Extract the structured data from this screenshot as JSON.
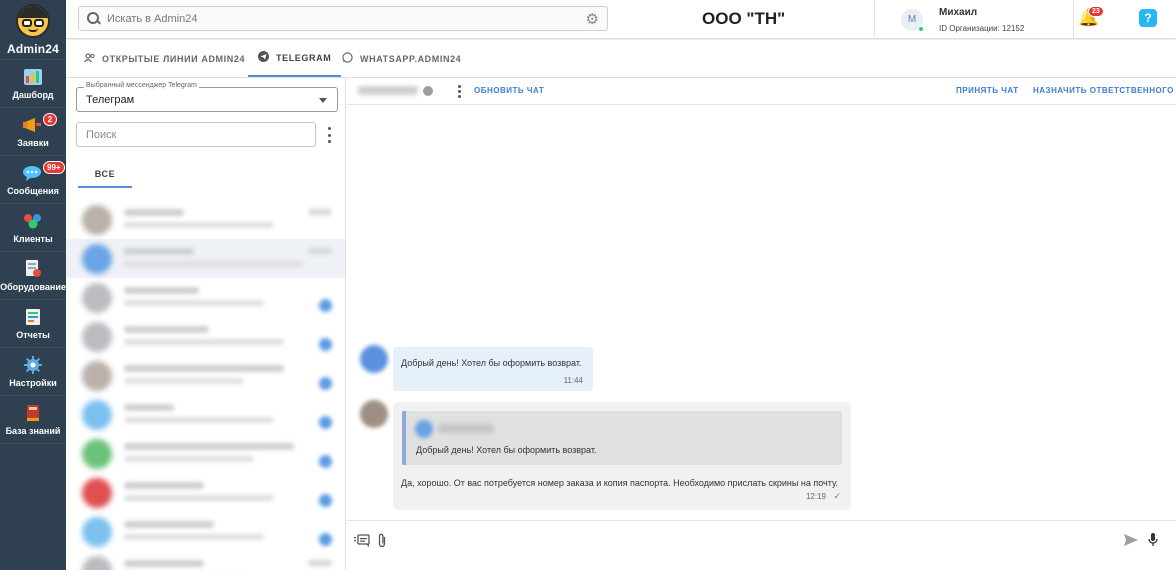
{
  "brand": {
    "name": "Admin24"
  },
  "sidebar": {
    "items": [
      {
        "label": "Дашборд",
        "icon": "dashboard-icon"
      },
      {
        "label": "Заявки",
        "icon": "megaphone-icon",
        "badge": "2"
      },
      {
        "label": "Сообщения",
        "icon": "chat-icon",
        "badge": "99+"
      },
      {
        "label": "Клиенты",
        "icon": "clients-icon"
      },
      {
        "label": "Оборудование",
        "icon": "equipment-icon"
      },
      {
        "label": "Отчеты",
        "icon": "reports-icon"
      },
      {
        "label": "Настройки",
        "icon": "gear-icon"
      },
      {
        "label": "База знаний",
        "icon": "book-icon"
      }
    ]
  },
  "header": {
    "search_placeholder": "Искать в Admin24",
    "company": "ООО \"ТН\"",
    "user": {
      "initial": "M",
      "name": "Михаил",
      "org": "ID Организации: 12152"
    },
    "notifications": "23",
    "help": "?"
  },
  "tabs": [
    {
      "label": "ОТКРЫТЫЕ ЛИНИИ ADMIN24",
      "icon": "users-icon"
    },
    {
      "label": "TELEGRAM",
      "icon": "telegram-icon",
      "active": true
    },
    {
      "label": "WHATSAPP.ADMIN24",
      "icon": "whatsapp-icon"
    }
  ],
  "left": {
    "messenger_legend": "Выбранный мессенджер Telegram",
    "messenger_value": "Телеграм",
    "search_placeholder": "Поиск",
    "filter_all": "ВСЕ"
  },
  "chat": {
    "actions": {
      "refresh": "ОБНОВИТЬ ЧАТ",
      "accept": "ПРИНЯТЬ ЧАТ",
      "assign": "НАЗНАЧИТЬ ОТВЕТСТВЕННОГО"
    },
    "messages": [
      {
        "text": "Добрый день! Хотел бы оформить возврат.",
        "time": "11:44"
      },
      {
        "quote": "Добрый день! Хотел бы оформить возврат.",
        "text": "Да, хорошо. От вас потребуется номер заказа и копия паспорта. Необходимо прислать скрины на почту.",
        "time": "12:19"
      }
    ]
  },
  "colors": {
    "sidebar": "#2f4050",
    "accent": "#3b7fd1",
    "badge": "#e53935"
  }
}
